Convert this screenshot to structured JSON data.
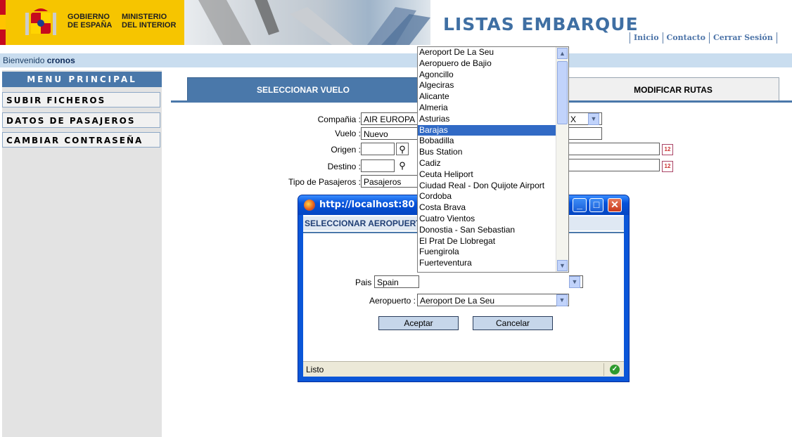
{
  "header": {
    "gov_line1": "GOBIERNO",
    "gov_line2": "DE ESPAÑA",
    "ministry_line1": "MINISTERIO",
    "ministry_line2": "DEL INTERIOR",
    "app_title": "LISTAS EMBARQUE",
    "links": [
      "Inicio",
      "Contacto",
      "Cerrar Sesión"
    ]
  },
  "welcome": {
    "prefix": "Bienvenido",
    "user": "cronos"
  },
  "sidebar": {
    "title": "MENU PRINCIPAL",
    "items": [
      {
        "label": "SUBIR FICHEROS"
      },
      {
        "label": "DATOS DE PASAJEROS"
      },
      {
        "label": "CAMBIAR CONTRASEÑA"
      }
    ]
  },
  "tabs": [
    {
      "label": "SELECCIONAR VUELO",
      "active": true
    },
    {
      "label": "MODIFICAR RUTAS",
      "active": false
    }
  ],
  "form": {
    "compania_label": "Compañia :",
    "compania_value": "AIR EUROPA",
    "compania_right_fragment": "X",
    "vuelo_label": "Vuelo :",
    "vuelo_value": "Nuevo",
    "origen_label": "Origen :",
    "origen_value": "",
    "destino_label": "Destino :",
    "destino_value": "",
    "tipo_label": "Tipo de Pasajeros :",
    "tipo_value": "Pasajeros"
  },
  "popup": {
    "window_title": "http://localhost:80",
    "header": "SELECCIONAR AEROPUERTO",
    "pais_label": "Pais :",
    "pais_value": "Spain",
    "aeropuerto_label": "Aeropuerto :",
    "aeropuerto_value": "Aeroport De La Seu",
    "accept_label": "Aceptar",
    "cancel_label": "Cancelar",
    "status": "Listo"
  },
  "dropdown": {
    "selected": "Barajas",
    "options": [
      "Aeroport De La Seu",
      "Aeropuero de Bajio",
      "Agoncillo",
      "Algeciras",
      "Alicante",
      "Almeria",
      "Asturias",
      "Barajas",
      "Bobadilla",
      "Bus Station",
      "Cadiz",
      "Ceuta Heliport",
      "Ciudad Real - Don Quijote Airport",
      "Cordoba",
      "Costa Brava",
      "Cuatro Vientos",
      "Donostia - San Sebastian",
      "El Prat De Llobregat",
      "Fuengirola",
      "Fuerteventura"
    ]
  },
  "colors": {
    "accent": "#4a78aa",
    "gov_yellow": "#f6c500",
    "title_blue": "#3f6fa3",
    "selection": "#316ac5",
    "xp_blue": "#0552da"
  }
}
